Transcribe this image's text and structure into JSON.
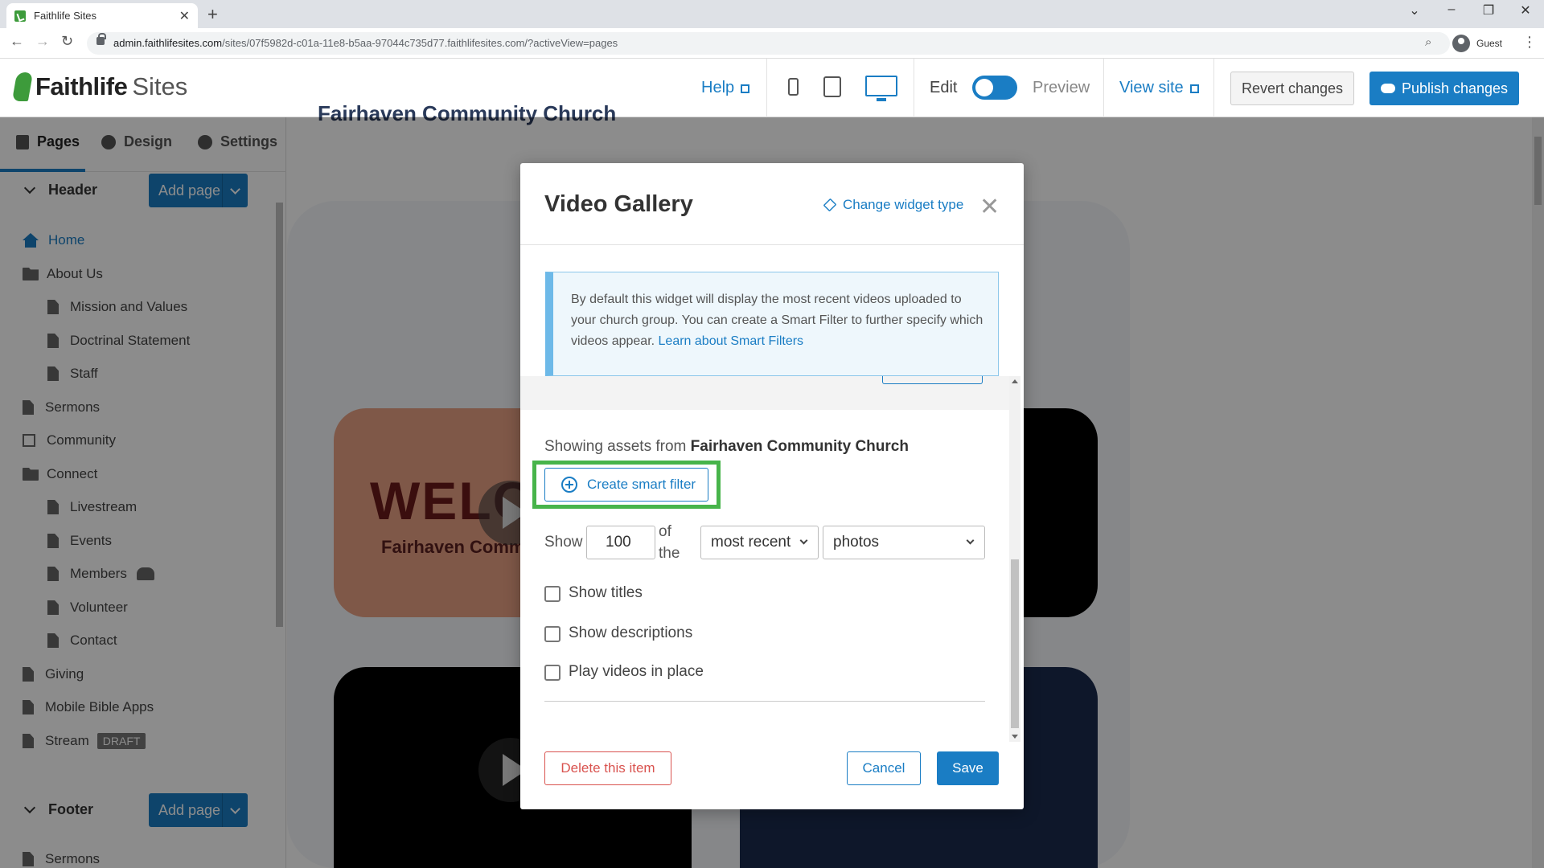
{
  "browser": {
    "tab_title": "Faithlife Sites",
    "url_host": "admin.faithlifesites.com",
    "url_path": "/sites/07f5982d-c01a-11e8-b5aa-97044c735d77.faithlifesites.com/?activeView=pages",
    "profile": "Guest"
  },
  "header": {
    "logo_bold": "Faithlife",
    "logo_light": "Sites",
    "help": "Help",
    "edit": "Edit",
    "preview": "Preview",
    "view_site": "View site",
    "revert": "Revert changes",
    "publish": "Publish changes"
  },
  "sidebar": {
    "tabs": [
      "Pages",
      "Design",
      "Settings"
    ],
    "header_section": "Header",
    "footer_section": "Footer",
    "add_page": "Add page",
    "items": [
      {
        "label": "Home",
        "icon": "home-icon",
        "indent": 0
      },
      {
        "label": "About Us",
        "icon": "folder-icon",
        "indent": 0
      },
      {
        "label": "Mission and Values",
        "icon": "page-icon",
        "indent": 1
      },
      {
        "label": "Doctrinal Statement",
        "icon": "page-icon",
        "indent": 1
      },
      {
        "label": "Staff",
        "icon": "page-icon",
        "indent": 1
      },
      {
        "label": "Sermons",
        "icon": "page-icon",
        "indent": 0
      },
      {
        "label": "Community",
        "icon": "external-link-icon",
        "indent": 0
      },
      {
        "label": "Connect",
        "icon": "folder-icon",
        "indent": 0
      },
      {
        "label": "Livestream",
        "icon": "page-icon",
        "indent": 1
      },
      {
        "label": "Events",
        "icon": "page-icon",
        "indent": 1
      },
      {
        "label": "Members",
        "icon": "page-icon",
        "indent": 1
      },
      {
        "label": "Volunteer",
        "icon": "page-icon",
        "indent": 1
      },
      {
        "label": "Contact",
        "icon": "page-icon",
        "indent": 1
      },
      {
        "label": "Giving",
        "icon": "page-icon",
        "indent": 0
      },
      {
        "label": "Mobile Bible Apps",
        "icon": "page-icon",
        "indent": 0
      },
      {
        "label": "Stream",
        "icon": "page-icon",
        "indent": 0
      }
    ],
    "draft_badge": "DRAFT",
    "footer_items": [
      "Sermons"
    ]
  },
  "preview": {
    "site_title": "Fairhaven Community Church",
    "thumb_welcome": "WELC",
    "thumb_church": "Fairhaven Comm"
  },
  "modal": {
    "title": "Video Gallery",
    "change_type": "Change widget type",
    "info_text": "By default this widget will display the most recent videos uploaded to your church group. You can create a Smart Filter to further specify which videos appear. ",
    "info_link": "Learn about Smart Filters",
    "showing_prefix": "Showing assets from ",
    "showing_source": "Fairhaven Community Church",
    "create_filter": "Create smart filter",
    "show_label": "Show",
    "count": "100",
    "of_the": "of the",
    "sort_option": "most recent",
    "type_option": "photos",
    "checkboxes": [
      "Show titles",
      "Show descriptions",
      "Play videos in place"
    ],
    "delete": "Delete this item",
    "cancel": "Cancel",
    "save": "Save"
  },
  "colors": {
    "accent": "#1a7dc4",
    "highlight": "#47b44a",
    "danger": "#d9534f"
  }
}
